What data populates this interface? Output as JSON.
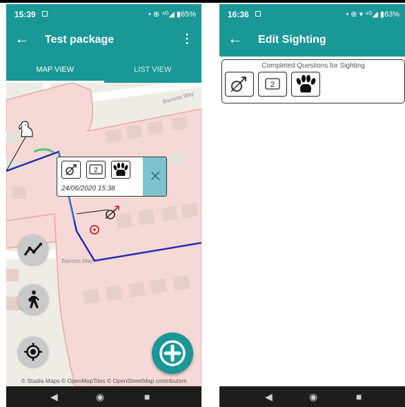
{
  "screens": [
    {
      "status": {
        "time": "15:39",
        "right": "• ⊕ ⁴ᴳ◢ ▮65%"
      },
      "appbar": {
        "back_glyph": "←",
        "title": "Test package",
        "menu_glyph": "⋮"
      },
      "tabs": [
        {
          "label": "MAP VIEW",
          "active": true
        },
        {
          "label": "LIST VIEW",
          "active": false
        }
      ],
      "map": {
        "street_labels": [
          "Barrons Way",
          "Barrons Way"
        ],
        "attribution": "© Stadia Maps © OpenMapTiles © OpenStreetMap contributors",
        "popup": {
          "count_value": "2",
          "date": "24/06/2020 15:38",
          "close_glyph": "✕"
        },
        "add_glyph": "+"
      }
    },
    {
      "status": {
        "time": "16:36",
        "right": "• ⊕ ▾ ⁴ᴳ◢ ▮63%"
      },
      "appbar": {
        "back_glyph": "←",
        "title": "Edit Sighting"
      },
      "panel": {
        "title": "Completed Questions for Sighting",
        "count_value": "2"
      }
    }
  ],
  "navbar": {
    "back": "◀",
    "home": "◉",
    "recent": "■"
  },
  "colors": {
    "primary": "#1a9797",
    "track_line": "#1f2bb5",
    "area_fill": "#f6d9d6",
    "area_border": "#e8a7a0",
    "popup_close": "#7fc4cc",
    "marker_red": "#cc2222"
  },
  "icons": [
    "back-arrow-icon",
    "overflow-menu-icon",
    "dog-icon",
    "male-neutered-icon",
    "count-icon",
    "paw-print-icon",
    "close-icon",
    "track-line-icon",
    "walking-person-icon",
    "locate-target-icon",
    "add-circle-icon"
  ]
}
